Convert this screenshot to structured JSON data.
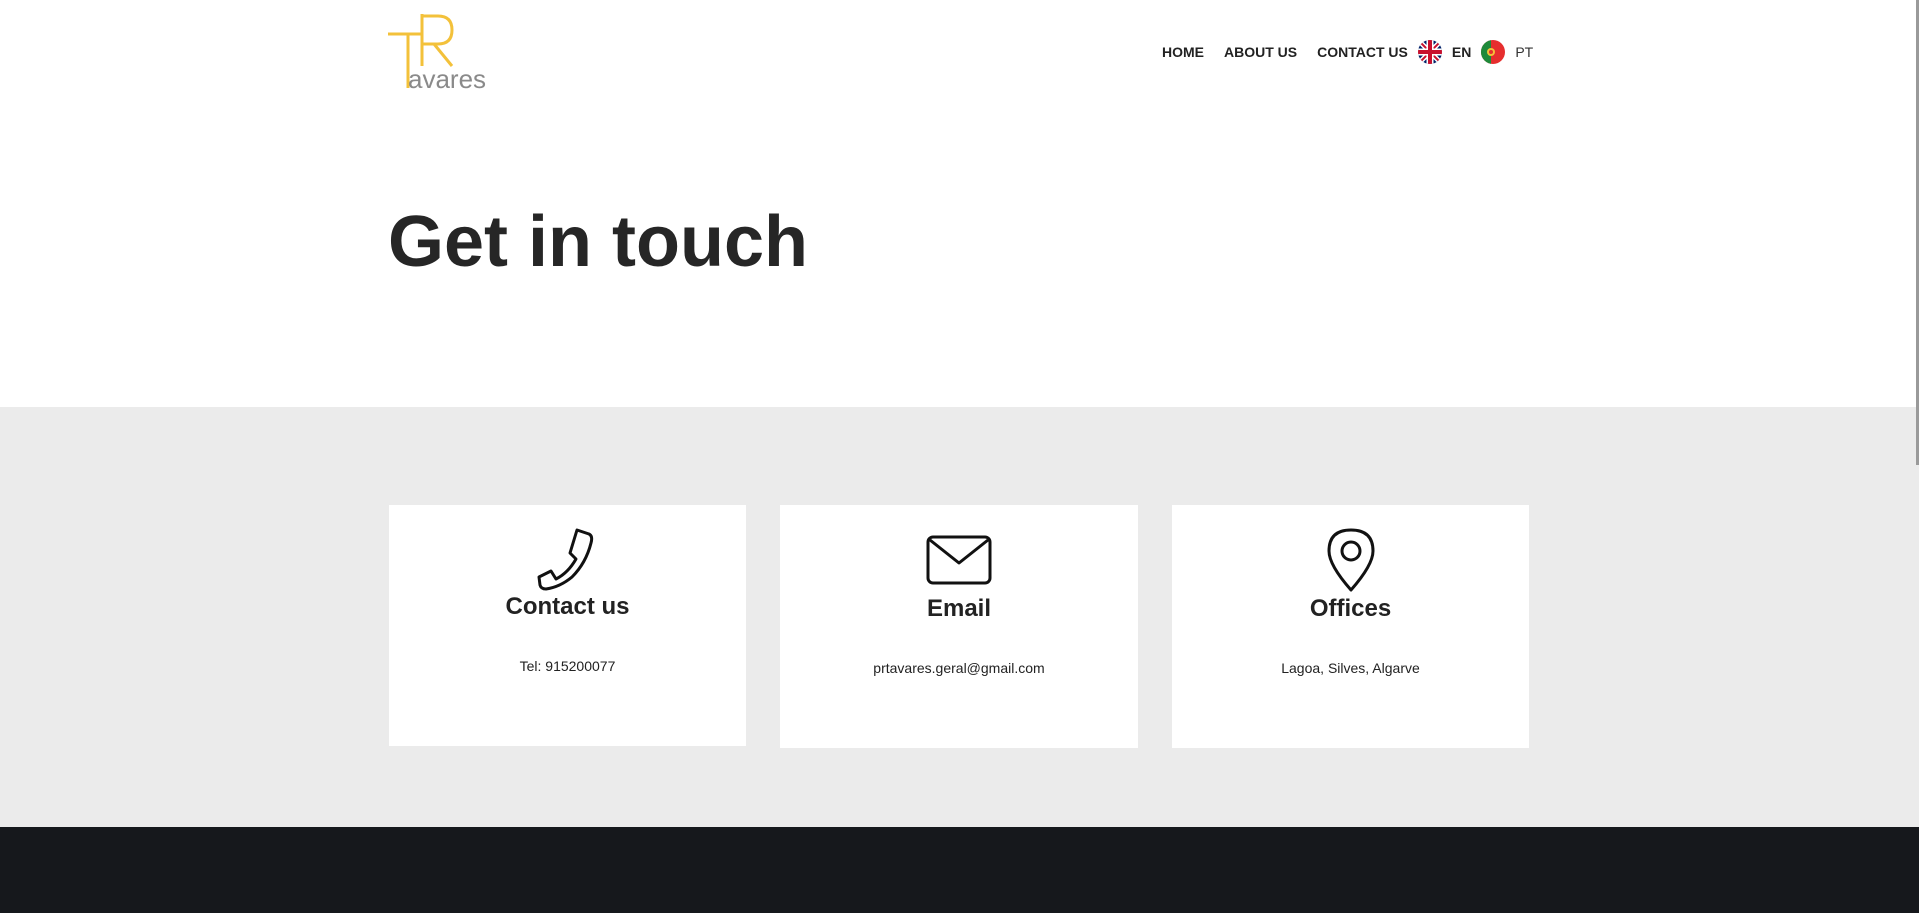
{
  "brand": {
    "logo_text": "avares",
    "colors": {
      "logo_gold": "#f3c13a",
      "logo_grey": "#8a8a8a",
      "footer_bg": "#16181c",
      "section_bg": "#ebebeb"
    }
  },
  "nav": {
    "items": [
      {
        "label": "HOME"
      },
      {
        "label": "ABOUT US"
      },
      {
        "label": "CONTACT US"
      }
    ],
    "languages": [
      {
        "code": "EN",
        "flag": "uk-flag-icon",
        "active": true
      },
      {
        "code": "PT",
        "flag": "portugal-flag-icon",
        "active": false
      }
    ]
  },
  "hero": {
    "title": "Get in touch"
  },
  "cards": [
    {
      "icon": "phone-icon",
      "title": "Contact us",
      "text": "Tel: 915200077"
    },
    {
      "icon": "envelope-icon",
      "title": "Email",
      "text": "prtavares.geral@gmail.com"
    },
    {
      "icon": "map-pin-icon",
      "title": "Offices",
      "text": "Lagoa, Silves, Algarve"
    }
  ]
}
